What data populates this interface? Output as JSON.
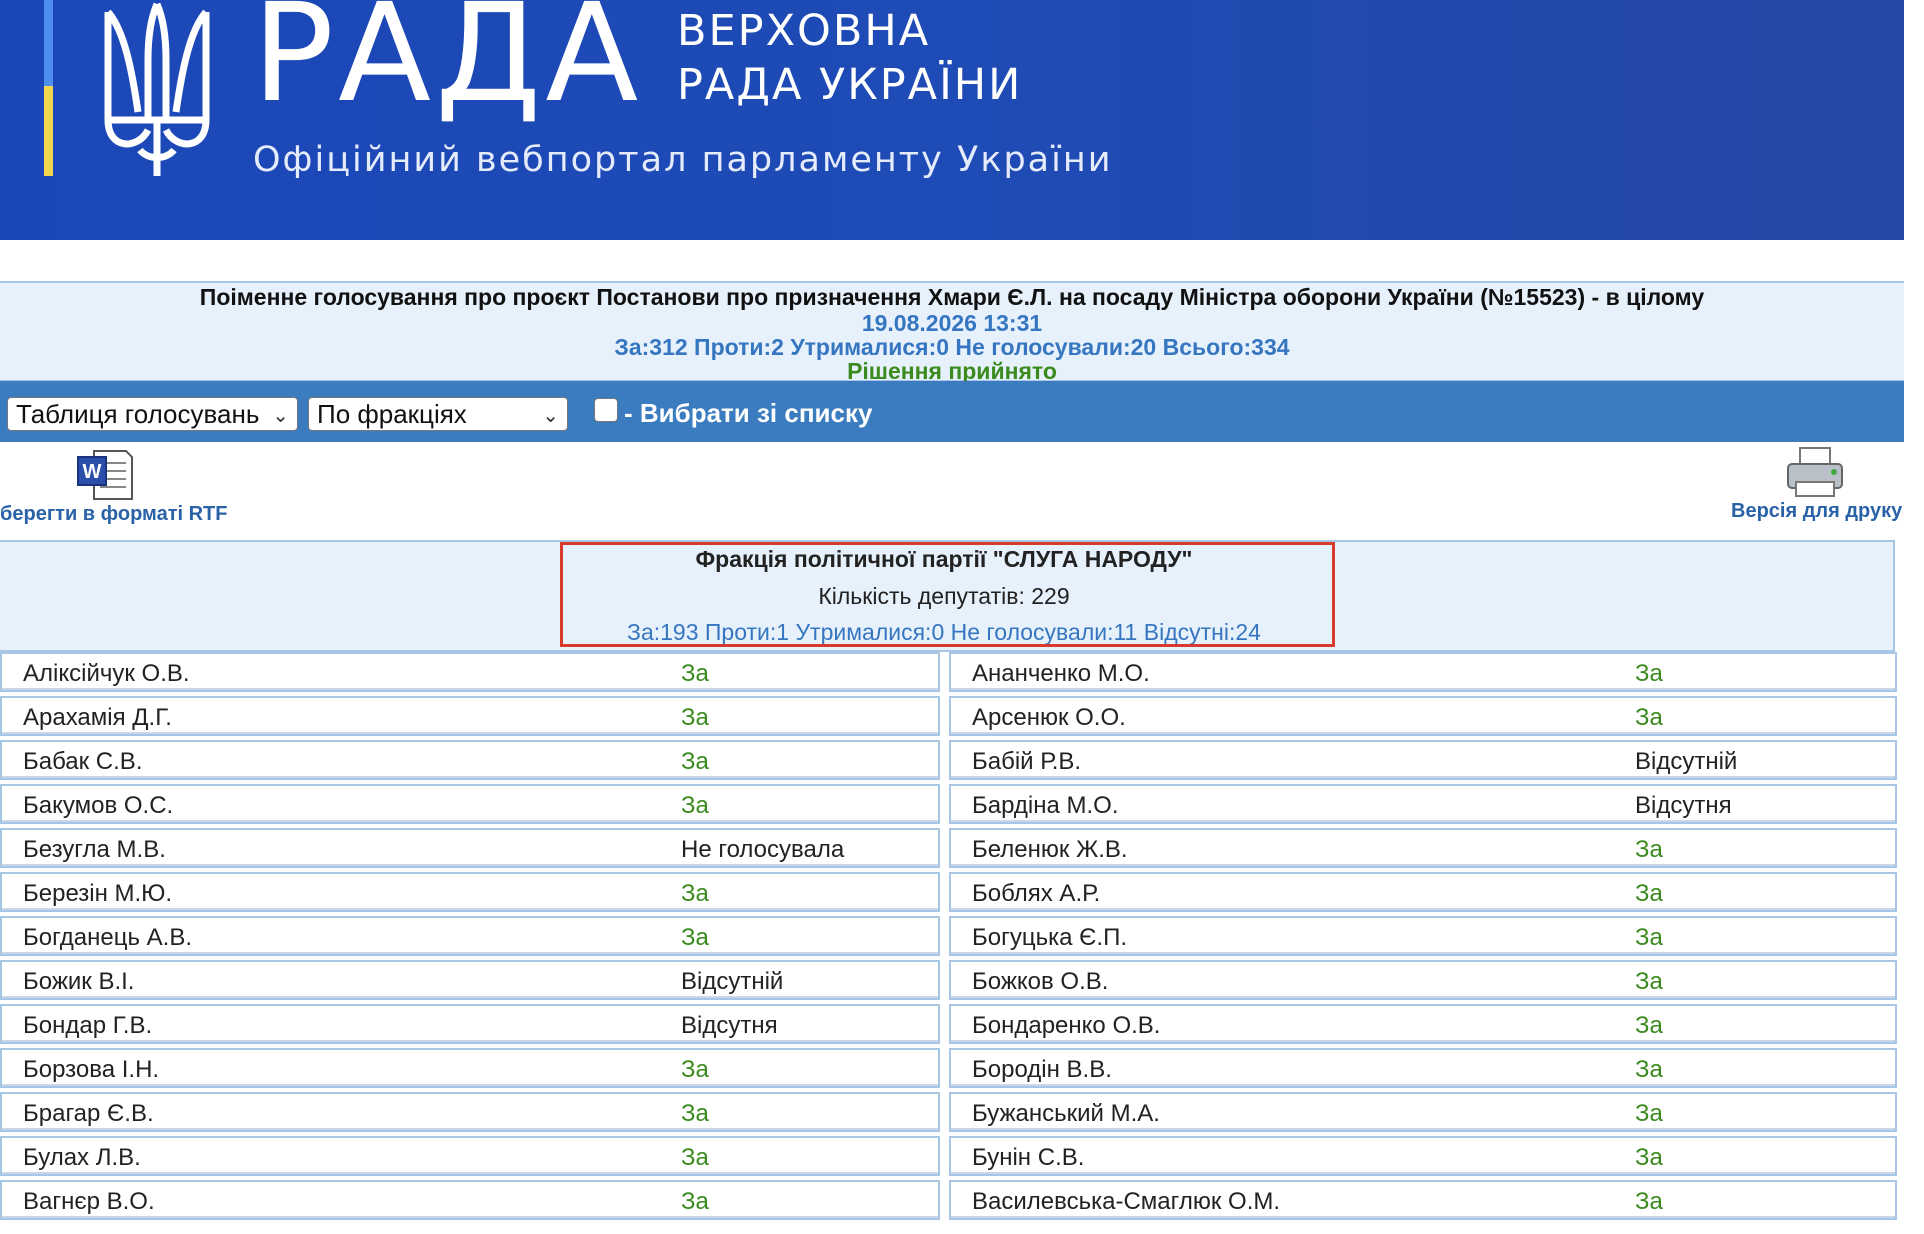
{
  "header": {
    "brand": "РАДА",
    "parliament_line1": "ВЕРХОВНА",
    "parliament_line2": "РАДА УКРАЇНИ",
    "subtitle": "Офіційний вебпортал парламенту України"
  },
  "vote": {
    "title": "Поіменне голосування про проєкт Постанови про призначення Хмари Є.Л. на посаду Міністра оборони України (№15523) - в цілому",
    "datetime": "19.08.2026 13:31",
    "stats": "За:312 Проти:2 Утрималися:0 Не голосували:20 Всього:334",
    "result": "Рішення прийнято"
  },
  "toolbar": {
    "view_select": "Таблиця голосувань",
    "group_select": "По фракціях",
    "choose_label": "- Вибрати зі списку",
    "choose_checked": false
  },
  "tools": {
    "rtf_label": "берегти в форматі RTF",
    "print_label": "Версія для друку"
  },
  "faction": {
    "name": "Фракція політичної партії \"СЛУГА НАРОДУ\"",
    "count": "Кількість депутатів: 229",
    "stats": "За:193 Проти:1 Утрималися:0 Не голосували:11 Відсутні:24"
  },
  "deputies_left": [
    {
      "name": "Аліксійчук О.В.",
      "vote": "За"
    },
    {
      "name": "Арахамія Д.Г.",
      "vote": "За"
    },
    {
      "name": "Бабак С.В.",
      "vote": "За"
    },
    {
      "name": "Бакумов О.С.",
      "vote": "За"
    },
    {
      "name": "Безугла М.В.",
      "vote": "Не голосувала"
    },
    {
      "name": "Березін М.Ю.",
      "vote": "За"
    },
    {
      "name": "Богданець А.В.",
      "vote": "За"
    },
    {
      "name": "Божик В.І.",
      "vote": "Відсутній"
    },
    {
      "name": "Бондар Г.В.",
      "vote": "Відсутня"
    },
    {
      "name": "Борзова І.Н.",
      "vote": "За"
    },
    {
      "name": "Брагар Є.В.",
      "vote": "За"
    },
    {
      "name": "Булах Л.В.",
      "vote": "За"
    },
    {
      "name": "Вагнєр В.О.",
      "vote": "За"
    }
  ],
  "deputies_right": [
    {
      "name": "Ананченко М.О.",
      "vote": "За"
    },
    {
      "name": "Арсенюк О.О.",
      "vote": "За"
    },
    {
      "name": "Бабій Р.В.",
      "vote": "Відсутній"
    },
    {
      "name": "Бардіна М.О.",
      "vote": "Відсутня"
    },
    {
      "name": "Беленюк Ж.В.",
      "vote": "За"
    },
    {
      "name": "Боблях А.Р.",
      "vote": "За"
    },
    {
      "name": "Богуцька Є.П.",
      "vote": "За"
    },
    {
      "name": "Божков О.В.",
      "vote": "За"
    },
    {
      "name": "Бондаренко О.В.",
      "vote": "За"
    },
    {
      "name": "Бородін В.В.",
      "vote": "За"
    },
    {
      "name": "Бужанський М.А.",
      "vote": "За"
    },
    {
      "name": "Бунін С.В.",
      "vote": "За"
    },
    {
      "name": "Василевська-Смаглюк О.М.",
      "vote": "За"
    }
  ],
  "colors": {
    "banner": "#1f4bb6",
    "toolbar": "#3b7cc0",
    "panel_bg": "#e6f1fb",
    "vote_for": "#3a8a1d",
    "link": "#3676c1",
    "highlight": "#d83a2c"
  },
  "icons": [
    "trident-icon",
    "word-document-icon",
    "printer-icon",
    "chevron-down-icon"
  ]
}
